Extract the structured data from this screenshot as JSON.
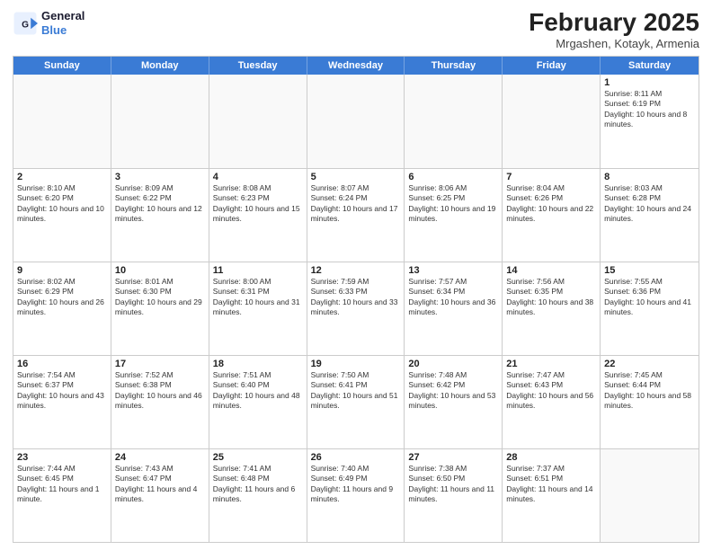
{
  "logo": {
    "line1": "General",
    "line2": "Blue"
  },
  "calendar": {
    "title": "February 2025",
    "subtitle": "Mrgashen, Kotayk, Armenia",
    "headers": [
      "Sunday",
      "Monday",
      "Tuesday",
      "Wednesday",
      "Thursday",
      "Friday",
      "Saturday"
    ],
    "weeks": [
      [
        {
          "day": "",
          "text": ""
        },
        {
          "day": "",
          "text": ""
        },
        {
          "day": "",
          "text": ""
        },
        {
          "day": "",
          "text": ""
        },
        {
          "day": "",
          "text": ""
        },
        {
          "day": "",
          "text": ""
        },
        {
          "day": "1",
          "text": "Sunrise: 8:11 AM\nSunset: 6:19 PM\nDaylight: 10 hours and 8 minutes."
        }
      ],
      [
        {
          "day": "2",
          "text": "Sunrise: 8:10 AM\nSunset: 6:20 PM\nDaylight: 10 hours and 10 minutes."
        },
        {
          "day": "3",
          "text": "Sunrise: 8:09 AM\nSunset: 6:22 PM\nDaylight: 10 hours and 12 minutes."
        },
        {
          "day": "4",
          "text": "Sunrise: 8:08 AM\nSunset: 6:23 PM\nDaylight: 10 hours and 15 minutes."
        },
        {
          "day": "5",
          "text": "Sunrise: 8:07 AM\nSunset: 6:24 PM\nDaylight: 10 hours and 17 minutes."
        },
        {
          "day": "6",
          "text": "Sunrise: 8:06 AM\nSunset: 6:25 PM\nDaylight: 10 hours and 19 minutes."
        },
        {
          "day": "7",
          "text": "Sunrise: 8:04 AM\nSunset: 6:26 PM\nDaylight: 10 hours and 22 minutes."
        },
        {
          "day": "8",
          "text": "Sunrise: 8:03 AM\nSunset: 6:28 PM\nDaylight: 10 hours and 24 minutes."
        }
      ],
      [
        {
          "day": "9",
          "text": "Sunrise: 8:02 AM\nSunset: 6:29 PM\nDaylight: 10 hours and 26 minutes."
        },
        {
          "day": "10",
          "text": "Sunrise: 8:01 AM\nSunset: 6:30 PM\nDaylight: 10 hours and 29 minutes."
        },
        {
          "day": "11",
          "text": "Sunrise: 8:00 AM\nSunset: 6:31 PM\nDaylight: 10 hours and 31 minutes."
        },
        {
          "day": "12",
          "text": "Sunrise: 7:59 AM\nSunset: 6:33 PM\nDaylight: 10 hours and 33 minutes."
        },
        {
          "day": "13",
          "text": "Sunrise: 7:57 AM\nSunset: 6:34 PM\nDaylight: 10 hours and 36 minutes."
        },
        {
          "day": "14",
          "text": "Sunrise: 7:56 AM\nSunset: 6:35 PM\nDaylight: 10 hours and 38 minutes."
        },
        {
          "day": "15",
          "text": "Sunrise: 7:55 AM\nSunset: 6:36 PM\nDaylight: 10 hours and 41 minutes."
        }
      ],
      [
        {
          "day": "16",
          "text": "Sunrise: 7:54 AM\nSunset: 6:37 PM\nDaylight: 10 hours and 43 minutes."
        },
        {
          "day": "17",
          "text": "Sunrise: 7:52 AM\nSunset: 6:38 PM\nDaylight: 10 hours and 46 minutes."
        },
        {
          "day": "18",
          "text": "Sunrise: 7:51 AM\nSunset: 6:40 PM\nDaylight: 10 hours and 48 minutes."
        },
        {
          "day": "19",
          "text": "Sunrise: 7:50 AM\nSunset: 6:41 PM\nDaylight: 10 hours and 51 minutes."
        },
        {
          "day": "20",
          "text": "Sunrise: 7:48 AM\nSunset: 6:42 PM\nDaylight: 10 hours and 53 minutes."
        },
        {
          "day": "21",
          "text": "Sunrise: 7:47 AM\nSunset: 6:43 PM\nDaylight: 10 hours and 56 minutes."
        },
        {
          "day": "22",
          "text": "Sunrise: 7:45 AM\nSunset: 6:44 PM\nDaylight: 10 hours and 58 minutes."
        }
      ],
      [
        {
          "day": "23",
          "text": "Sunrise: 7:44 AM\nSunset: 6:45 PM\nDaylight: 11 hours and 1 minute."
        },
        {
          "day": "24",
          "text": "Sunrise: 7:43 AM\nSunset: 6:47 PM\nDaylight: 11 hours and 4 minutes."
        },
        {
          "day": "25",
          "text": "Sunrise: 7:41 AM\nSunset: 6:48 PM\nDaylight: 11 hours and 6 minutes."
        },
        {
          "day": "26",
          "text": "Sunrise: 7:40 AM\nSunset: 6:49 PM\nDaylight: 11 hours and 9 minutes."
        },
        {
          "day": "27",
          "text": "Sunrise: 7:38 AM\nSunset: 6:50 PM\nDaylight: 11 hours and 11 minutes."
        },
        {
          "day": "28",
          "text": "Sunrise: 7:37 AM\nSunset: 6:51 PM\nDaylight: 11 hours and 14 minutes."
        },
        {
          "day": "",
          "text": ""
        }
      ]
    ]
  }
}
